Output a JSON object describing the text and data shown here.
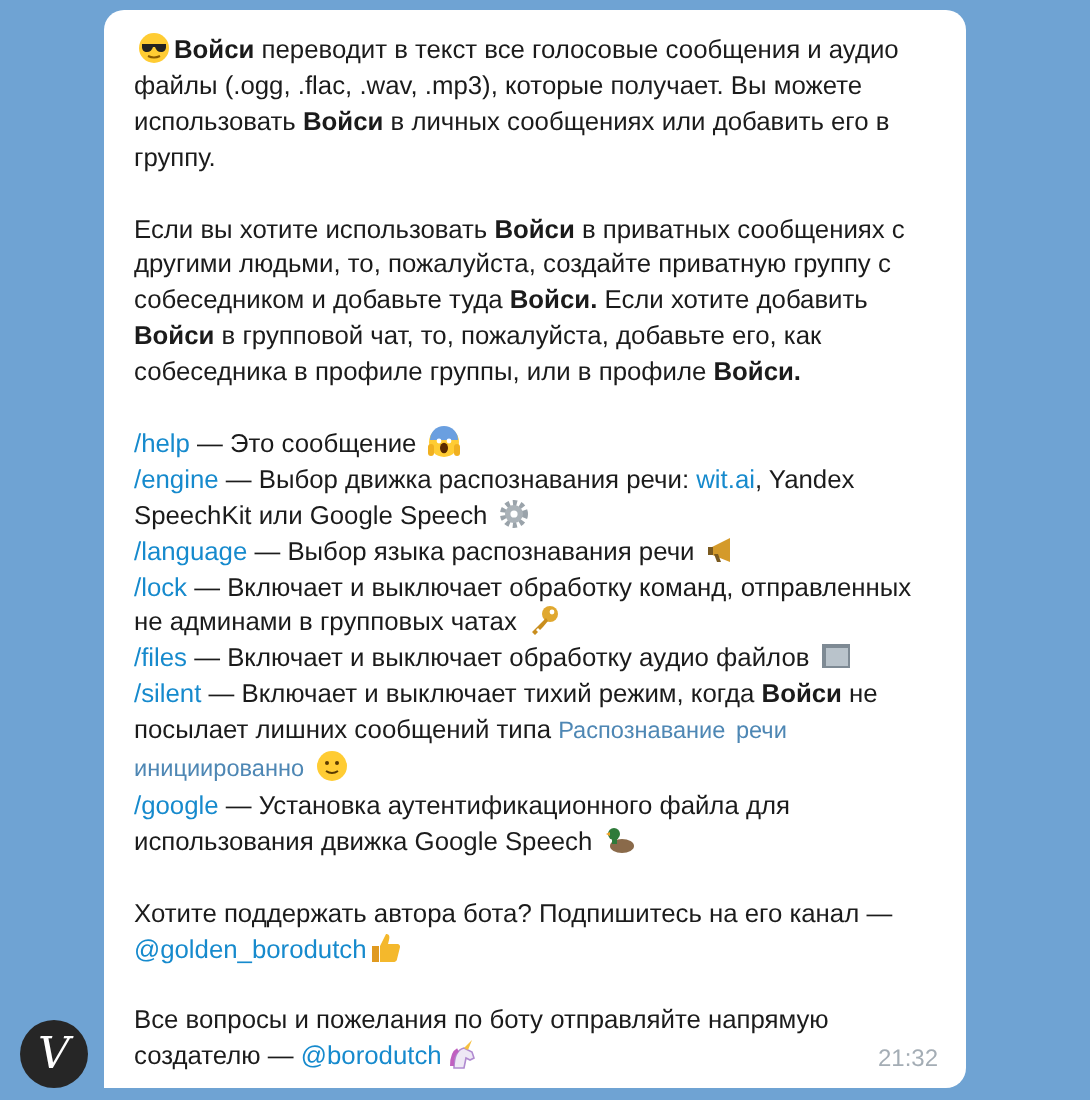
{
  "message": {
    "paragraphs": [
      {
        "lines": [
          {
            "segments": [
              {
                "kind": "emoji"
              },
              {
                "kind": "text",
                "text": "**Войси** переводит в текст все голосовые сообщения и аудио файлы (.ogg, .flac, .wav, .mp3), которые получает. Вы можете использовать **Войси** в личных сообщениях или добавить его в группу."
              }
            ]
          }
        ]
      },
      {
        "lines": [
          {
            "segments": [
              {
                "kind": "text",
                "text": "Если вы хотите использовать **Войси** в приватных сообщениях с другими людьми, то, пожалуйста, создайте приватную группу с собеседником и добавьте туда **Войси.** Если хотите добавить **Войси** в групповой чат, то, пожалуйста, добавьте его, как собеседника в профиле группы, или в профиле **Войси.**"
              }
            ]
          }
        ]
      },
      {
        "lines": [
          {
            "segments": [
              {
                "kind": "command",
                "text": "/help"
              },
              {
                "kind": "text",
                "text": " — Это сообщение "
              },
              {
                "kind": "emoji"
              }
            ]
          },
          {
            "segments": [
              {
                "kind": "command",
                "text": "/engine"
              },
              {
                "kind": "text",
                "text": " — Выбор движка распознавания речи: "
              },
              {
                "kind": "link",
                "text": "wit.ai"
              },
              {
                "kind": "text",
                "text": ", Yandex SpeechKit или Google Speech "
              },
              {
                "kind": "emoji"
              }
            ]
          },
          {
            "segments": [
              {
                "kind": "command",
                "text": "/language"
              },
              {
                "kind": "text",
                "text": " — Выбор языка распознавания речи "
              },
              {
                "kind": "emoji"
              }
            ]
          },
          {
            "segments": [
              {
                "kind": "command",
                "text": "/lock"
              },
              {
                "kind": "text",
                "text": " — Включает и выключает обработку команд, отправленных не админами в групповых чатах "
              },
              {
                "kind": "emoji"
              }
            ]
          },
          {
            "segments": [
              {
                "kind": "command",
                "text": "/files"
              },
              {
                "kind": "text",
                "text": " — Включает и выключает обработку аудио файлов "
              },
              {
                "kind": "emoji"
              }
            ]
          },
          {
            "segments": [
              {
                "kind": "command",
                "text": "/silent"
              },
              {
                "kind": "text",
                "text": " — Включает и выключает тихий режим, когда **Войси** не посылает лишних сообщений типа "
              },
              {
                "kind": "code",
                "text": "Распознавание  речи"
              },
              {
                "kind": "code",
                "text": "инициированно"
              },
              {
                "kind": "emoji"
              }
            ]
          },
          {
            "segments": [
              {
                "kind": "command",
                "text": "/google"
              },
              {
                "kind": "text",
                "text": " — Установка аутентификационного файла для использования движка Google Speech "
              },
              {
                "kind": "emoji"
              }
            ]
          }
        ]
      },
      {
        "lines": [
          {
            "segments": [
              {
                "kind": "text",
                "text": "Хотите поддержать автора бота? Подпишитесь на его канал — "
              },
              {
                "kind": "link",
                "text": "@golden_borodutch"
              },
              {
                "kind": "emoji"
              }
            ]
          }
        ]
      },
      {
        "lines": [
          {
            "segments": [
              {
                "kind": "text",
                "text": "Все вопросы и пожелания по боту отправляйте напрямую создателю — "
              },
              {
                "kind": "link",
                "text": "@borodutch"
              },
              {
                "kind": "emoji"
              }
            ]
          }
        ]
      }
    ],
    "time": "21:32"
  },
  "avatar": {
    "letter": "V"
  }
}
